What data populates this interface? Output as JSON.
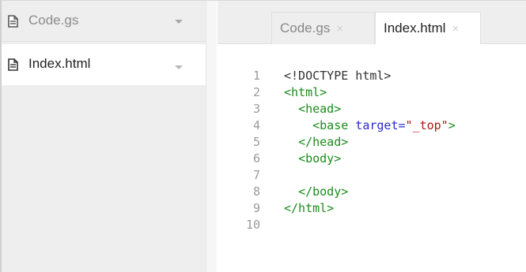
{
  "sidebar": {
    "files": [
      {
        "name": "Code.gs",
        "icon": "file-icon"
      },
      {
        "name": "Index.html",
        "icon": "file-icon"
      }
    ]
  },
  "tabs": [
    {
      "label": "Code.gs",
      "close": "×",
      "active": false
    },
    {
      "label": "Index.html",
      "close": "×",
      "active": true
    }
  ],
  "editor": {
    "line_numbers": [
      "1",
      "2",
      "3",
      "4",
      "5",
      "6",
      "7",
      "8",
      "9",
      "10"
    ],
    "code": [
      {
        "doctype": "<!DOCTYPE html>"
      },
      {
        "tag": "<html>"
      },
      {
        "indent": "  ",
        "tag": "<head>"
      },
      {
        "indent": "    ",
        "tag_open": "<base",
        "attr": " target=",
        "value": "\"_top\"",
        "tag_close": ">"
      },
      {
        "indent": "  ",
        "tag": "</head>"
      },
      {
        "indent": "  ",
        "tag": "<body>"
      },
      {
        "indent": ""
      },
      {
        "indent": "  ",
        "tag": "</body>"
      },
      {
        "tag": "</html>"
      },
      {
        "indent": ""
      }
    ]
  },
  "colors": {
    "tag": "#1a8c1a",
    "attribute": "#2a2ad0",
    "string": "#b01515",
    "line_number": "#9a9a9a"
  }
}
